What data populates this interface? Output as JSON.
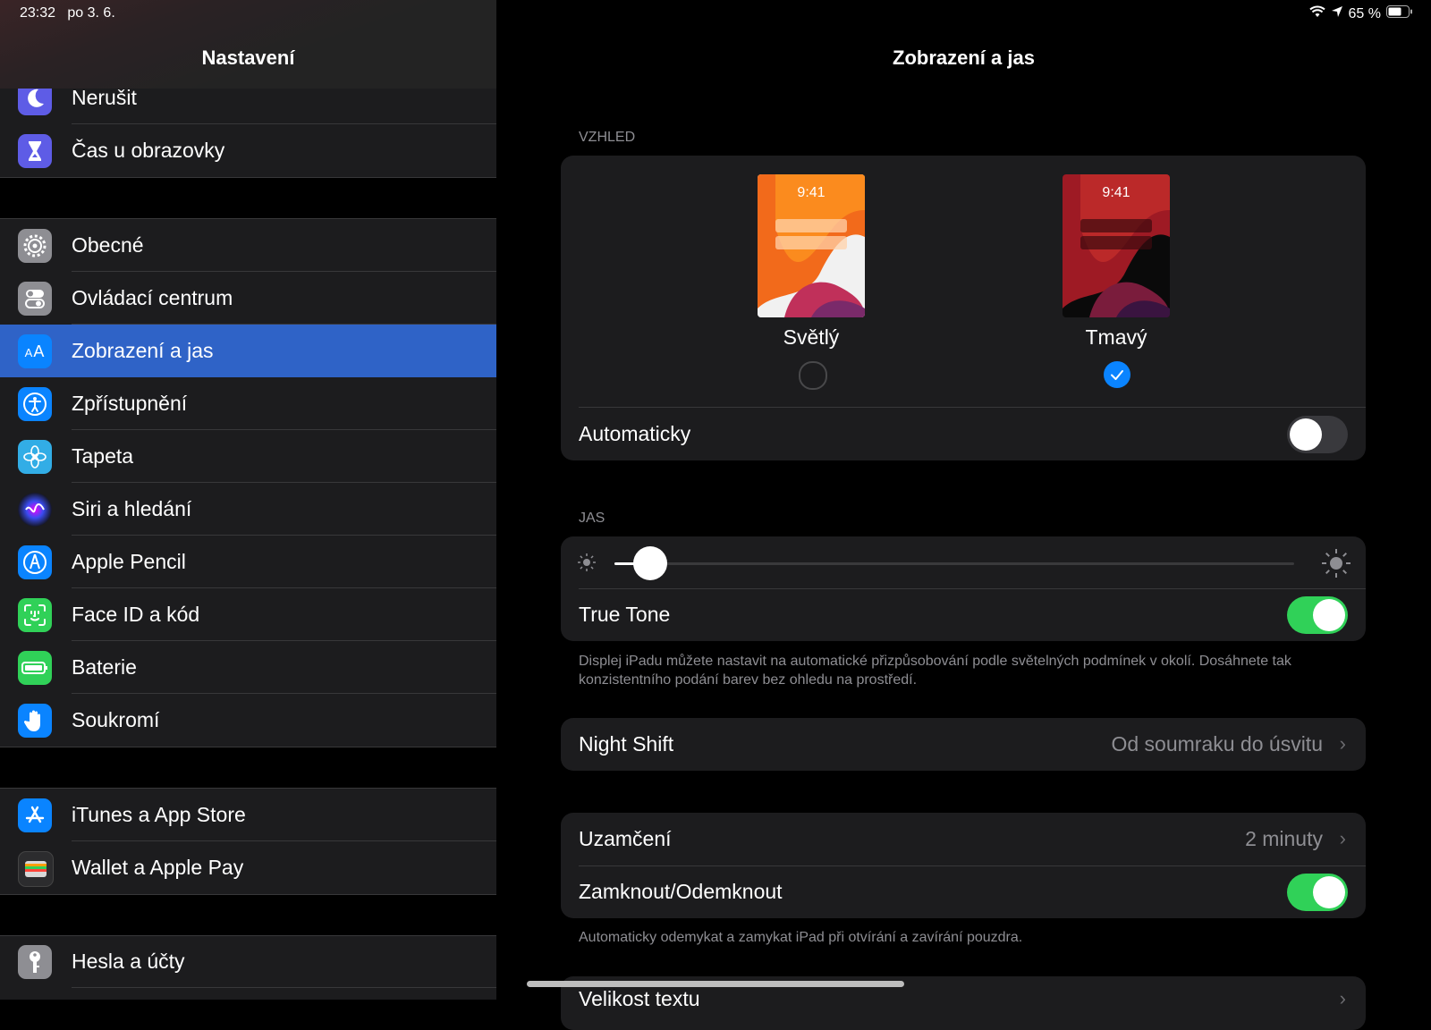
{
  "status": {
    "time": "23:32",
    "date": "po 3. 6.",
    "battery": "65 %"
  },
  "sidebar": {
    "title": "Nastavení",
    "items": [
      {
        "label": "Nerušit",
        "icon": "moon-icon",
        "color": "#5e5ce6"
      },
      {
        "label": "Čas u obrazovky",
        "icon": "hourglass-icon",
        "color": "#5e5ce6"
      },
      {
        "label": "Obecné",
        "icon": "gear-icon",
        "color": "#8e8e93"
      },
      {
        "label": "Ovládací centrum",
        "icon": "switches-icon",
        "color": "#8e8e93"
      },
      {
        "label": "Zobrazení a jas",
        "icon": "text-size-icon",
        "color": "#0a84ff",
        "selected": true
      },
      {
        "label": "Zpřístupnění",
        "icon": "accessibility-icon",
        "color": "#0a84ff"
      },
      {
        "label": "Tapeta",
        "icon": "flower-icon",
        "color": "#32ade6"
      },
      {
        "label": "Siri a hledání",
        "icon": "siri-icon",
        "color": "#1c1c3c"
      },
      {
        "label": "Apple Pencil",
        "icon": "pencil-icon",
        "color": "#0a84ff"
      },
      {
        "label": "Face ID a kód",
        "icon": "face-id-icon",
        "color": "#30d158"
      },
      {
        "label": "Baterie",
        "icon": "battery-icon",
        "color": "#30d158"
      },
      {
        "label": "Soukromí",
        "icon": "hand-icon",
        "color": "#0a84ff"
      },
      {
        "label": "iTunes a App Store",
        "icon": "app-store-icon",
        "color": "#0a84ff"
      },
      {
        "label": "Wallet a Apple Pay",
        "icon": "wallet-icon",
        "color": "#2c2c2e"
      },
      {
        "label": "Hesla a účty",
        "icon": "key-icon",
        "color": "#8e8e93"
      }
    ]
  },
  "main": {
    "title": "Zobrazení a jas",
    "appearance": {
      "section_label": "VZHLED",
      "light": {
        "preview_time": "9:41",
        "label": "Světlý",
        "selected": false
      },
      "dark": {
        "preview_time": "9:41",
        "label": "Tmavý",
        "selected": true
      },
      "automatic_label": "Automaticky",
      "automatic_on": false
    },
    "brightness": {
      "section_label": "JAS",
      "level": 0.04,
      "true_tone_label": "True Tone",
      "true_tone_on": true,
      "note": "Displej iPadu můžete nastavit na automatické přizpůsobování podle světelných podmínek v okolí. Dosáhnete tak konzistentního podání barev bez ohledu na prostředí."
    },
    "night_shift": {
      "label": "Night Shift",
      "value": "Od soumraku do úsvitu"
    },
    "lock": {
      "auto_lock_label": "Uzamčení",
      "auto_lock_value": "2 minuty",
      "lock_unlock_label": "Zamknout/Odemknout",
      "lock_unlock_on": true,
      "note": "Automaticky odemykat a zamykat iPad při otvírání a zavírání pouzdra."
    },
    "text_size_label": "Velikost textu"
  },
  "colors": {
    "accent": "#0a84ff",
    "toggle_on": "#30d158",
    "selected_row": "#2f63c7"
  }
}
